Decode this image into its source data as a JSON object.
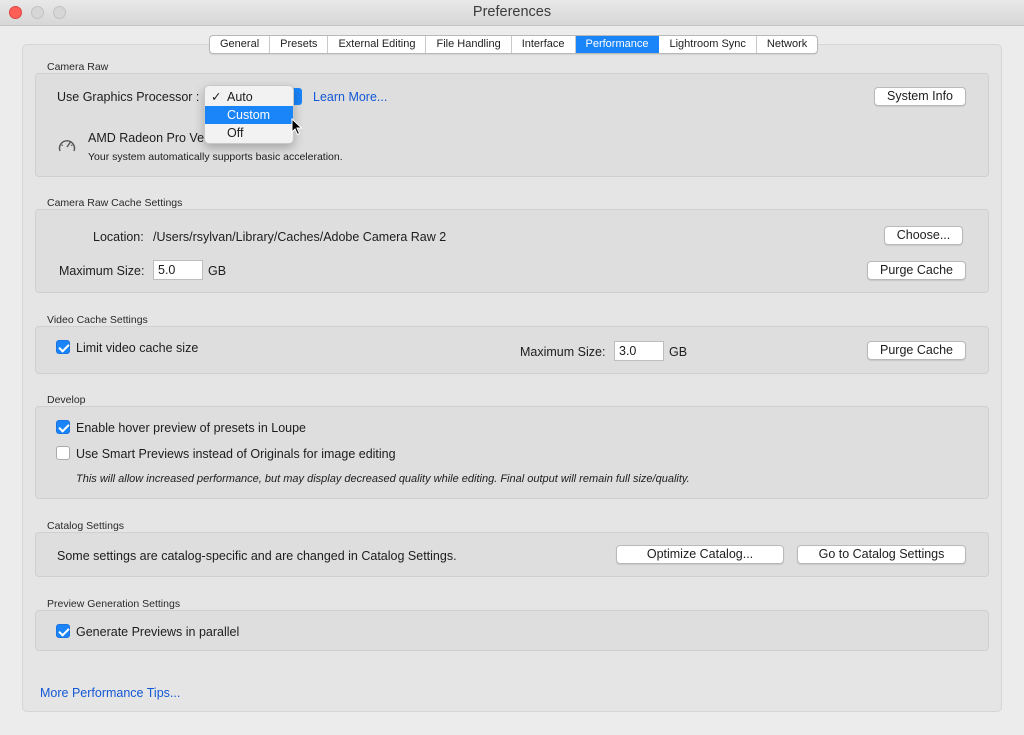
{
  "window": {
    "title": "Preferences"
  },
  "tabs": [
    "General",
    "Presets",
    "External Editing",
    "File Handling",
    "Interface",
    "Performance",
    "Lightroom Sync",
    "Network"
  ],
  "active_tab": "Performance",
  "camera_raw": {
    "section_label": "Camera Raw",
    "gpu_label": "Use Graphics Processor :",
    "gpu_options": [
      "Auto",
      "Custom",
      "Off"
    ],
    "gpu_checked": "Auto",
    "gpu_highlighted": "Custom",
    "learn_more": "Learn More...",
    "system_info": "System Info",
    "gpu_name": "AMD Radeon Pro Ve",
    "gpu_status": "Your system automatically supports basic acceleration.",
    "check_mark": "✓"
  },
  "cache": {
    "section_label": "Camera Raw Cache Settings",
    "location_label": "Location:",
    "location_value": "/Users/rsylvan/Library/Caches/Adobe Camera Raw 2",
    "choose": "Choose...",
    "max_size_label": "Maximum Size:",
    "max_size_value": "5.0",
    "unit": "GB",
    "purge": "Purge Cache"
  },
  "video_cache": {
    "section_label": "Video Cache Settings",
    "limit_label": "Limit video cache size",
    "limit_checked": true,
    "max_size_label": "Maximum Size:",
    "max_size_value": "3.0",
    "unit": "GB",
    "purge": "Purge Cache"
  },
  "develop": {
    "section_label": "Develop",
    "hover_label": "Enable hover preview of presets in Loupe",
    "hover_checked": true,
    "smart_label": "Use Smart Previews instead of Originals for image editing",
    "smart_checked": false,
    "note": "This will allow increased performance, but may display decreased quality while editing. Final output will remain full size/quality."
  },
  "catalog": {
    "section_label": "Catalog Settings",
    "description": "Some settings are catalog-specific and are changed in Catalog Settings.",
    "optimize": "Optimize Catalog...",
    "goto": "Go to Catalog Settings"
  },
  "preview": {
    "section_label": "Preview Generation Settings",
    "parallel_label": "Generate Previews in parallel",
    "parallel_checked": true
  },
  "footer": {
    "tips_link": "More Performance Tips..."
  },
  "colors": {
    "accent": "#1a84f9",
    "link": "#1358d6",
    "close": "#fe5f57"
  }
}
